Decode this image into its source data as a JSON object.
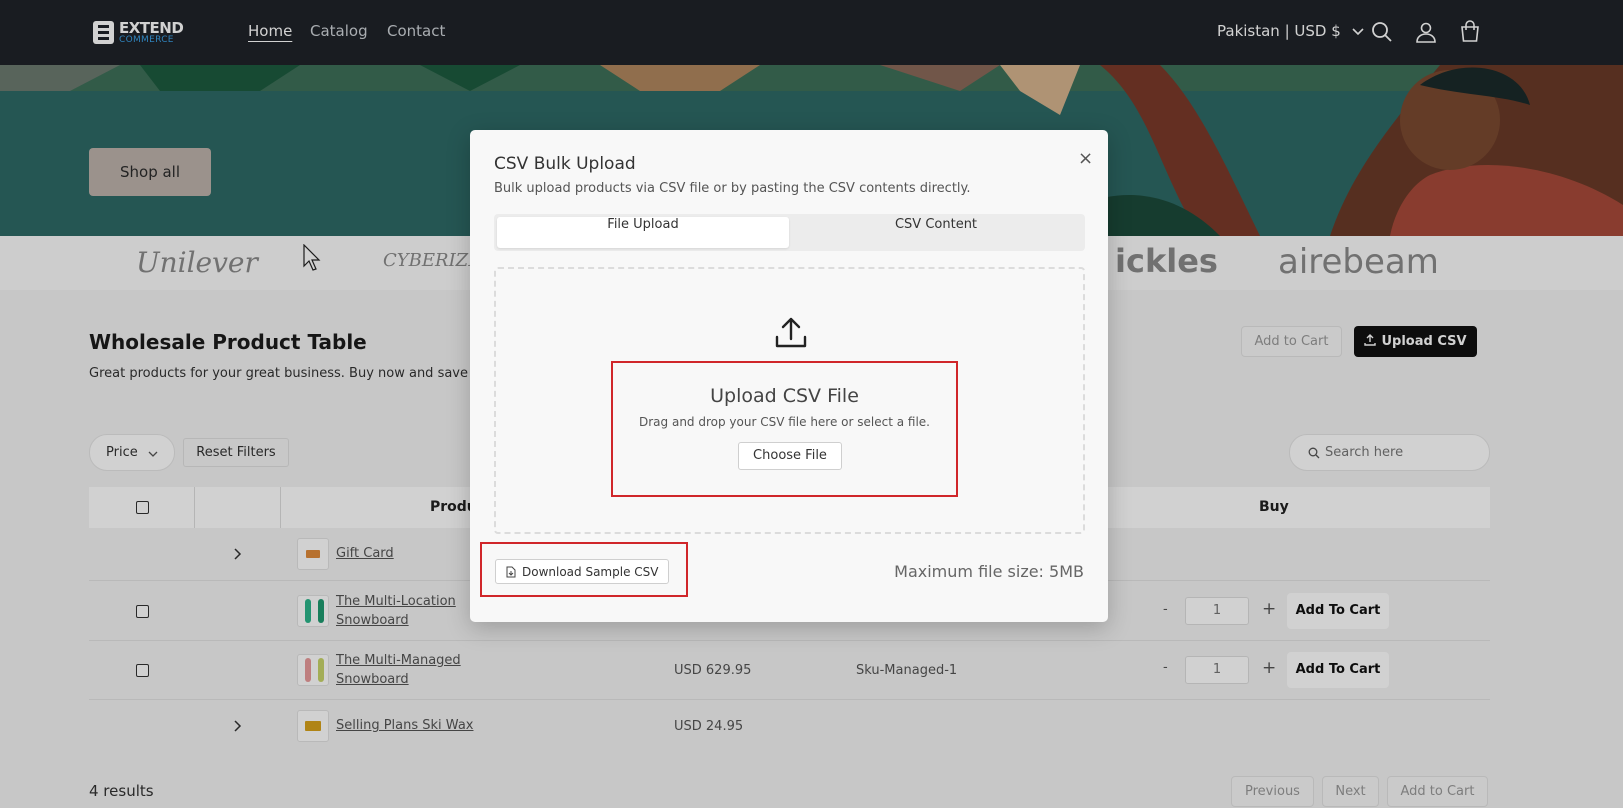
{
  "header": {
    "logo_main": "EXTEND",
    "logo_sub": "COMMERCE",
    "nav": [
      "Home",
      "Catalog",
      "Contact"
    ],
    "locale": "Pakistan | USD $",
    "icons": [
      "search-icon",
      "account-icon",
      "cart-icon"
    ]
  },
  "hero": {
    "shop_all": "Shop all"
  },
  "brands": [
    "Unilever",
    "CYBERIZE",
    "ickles",
    "airebeam"
  ],
  "section": {
    "title": "Wholesale Product Table",
    "subtitle": "Great products for your great business. Buy now and save up",
    "add_to_cart": "Add to Cart",
    "upload_csv": "Upload CSV"
  },
  "filters": {
    "price": "Price",
    "reset": "Reset Filters",
    "search_placeholder": "Search here"
  },
  "table": {
    "headers": {
      "product": "Produ",
      "buy": "Buy"
    },
    "rows": [
      {
        "name": "Gift Card",
        "price": "",
        "sku": ""
      },
      {
        "name": "The Multi-Location Snowboard",
        "price": "",
        "sku": "",
        "qty": "1",
        "add": "Add To Cart"
      },
      {
        "name": "The Multi-Managed Snowboard",
        "price": "USD 629.95",
        "sku": "Sku-Managed-1",
        "qty": "1",
        "add": "Add To Cart"
      },
      {
        "name": "Selling Plans Ski Wax",
        "price": "USD 24.95",
        "sku": ""
      }
    ],
    "results": "4 results",
    "pagination": {
      "previous": "Previous",
      "next": "Next",
      "add_to_cart": "Add to Cart"
    }
  },
  "modal": {
    "title": "CSV Bulk Upload",
    "subtitle": "Bulk upload products via CSV file or by pasting the CSV contents directly.",
    "tabs": [
      "File Upload",
      "CSV Content"
    ],
    "upload_title": "Upload CSV File",
    "upload_sub": "Drag and drop your CSV file here or select a file.",
    "choose_file": "Choose File",
    "download_sample": "Download Sample CSV",
    "max_size": "Maximum file size: 5MB",
    "close": "×"
  }
}
